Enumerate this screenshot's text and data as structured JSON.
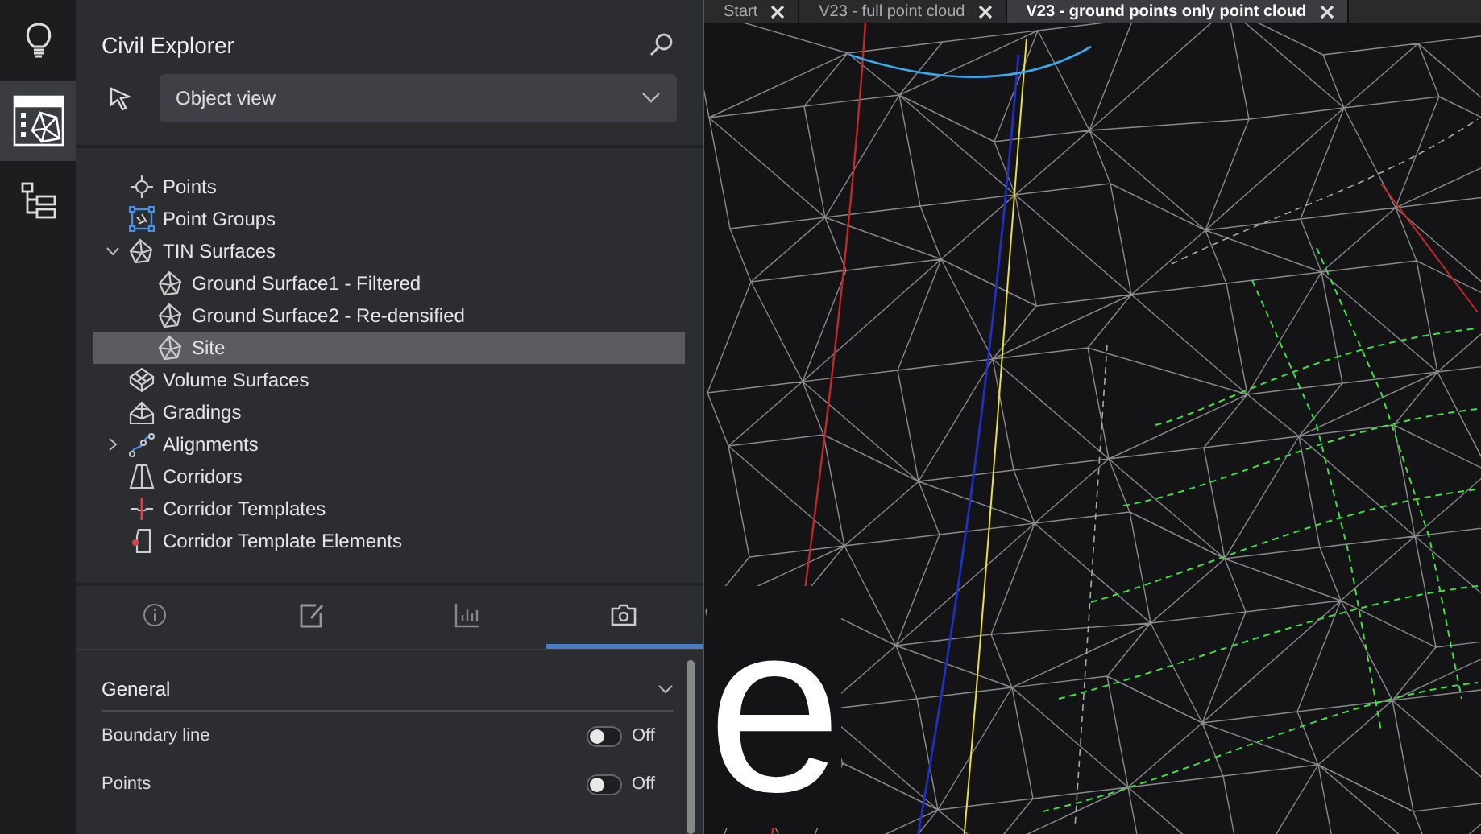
{
  "rail": [
    {
      "kind": "bulb",
      "selected": false
    },
    {
      "kind": "civil-explorer",
      "selected": true
    },
    {
      "kind": "tree",
      "selected": false
    }
  ],
  "panel": {
    "title": "Civil Explorer",
    "view_select": {
      "value": "Object view"
    },
    "tree": [
      {
        "label": "Points",
        "kind": "point",
        "selected": false
      },
      {
        "label": "Point Groups",
        "kind": "point-group",
        "selected": false
      },
      {
        "label": "TIN Surfaces",
        "kind": "tin-surface",
        "selected": false,
        "expanded": true,
        "children": [
          {
            "label": "Ground Surface1 - Filtered",
            "kind": "tin-surface",
            "selected": false
          },
          {
            "label": "Ground Surface2 - Re-densified",
            "kind": "tin-surface",
            "selected": false
          },
          {
            "label": "Site",
            "kind": "tin-surface",
            "selected": true
          }
        ]
      },
      {
        "label": "Volume Surfaces",
        "kind": "volume-surface",
        "selected": false
      },
      {
        "label": "Gradings",
        "kind": "grading",
        "selected": false
      },
      {
        "label": "Alignments",
        "kind": "alignment",
        "selected": false,
        "expanded": false
      },
      {
        "label": "Corridors",
        "kind": "corridor",
        "selected": false
      },
      {
        "label": "Corridor Templates",
        "kind": "corridor-template",
        "selected": false
      },
      {
        "label": "Corridor Template Elements",
        "kind": "template-element",
        "selected": false
      }
    ],
    "tabs": [
      {
        "kind": "info",
        "selected": false
      },
      {
        "kind": "edit",
        "selected": false
      },
      {
        "kind": "chart",
        "selected": false
      },
      {
        "kind": "camera",
        "selected": true
      }
    ],
    "section": {
      "title": "General",
      "expanded": true
    },
    "toggles": [
      {
        "label": "Boundary line",
        "on": false,
        "state": "Off"
      },
      {
        "label": "Points",
        "on": false,
        "state": "Off"
      }
    ]
  },
  "document_tabs": [
    {
      "title": "Start",
      "selected": false
    },
    {
      "title": "V23 - full point cloud",
      "selected": false
    },
    {
      "title": "V23 - ground points only point cloud",
      "selected": true
    }
  ],
  "viewport": {
    "text": "e"
  }
}
